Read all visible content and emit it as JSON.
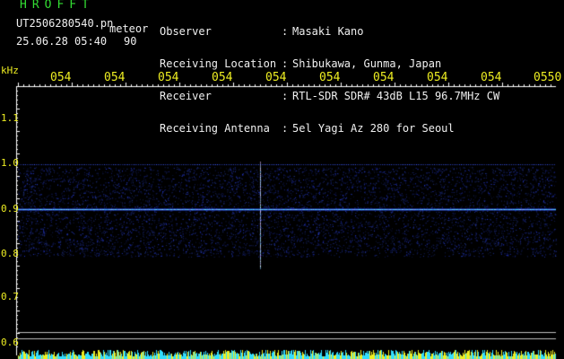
{
  "header": {
    "logo": "HROFFT",
    "filename": "UT2506280540.pn",
    "mode": "meteor",
    "datetime": "25.06.28 05:40",
    "level": "90",
    "fields": [
      {
        "label": "Observer",
        "value": "Masaki Kano"
      },
      {
        "label": "Receiving Location",
        "value": "Shibukawa, Gunma, Japan"
      },
      {
        "label": "Receiver",
        "value": "RTL-SDR SDR# 43dB L15 96.7MHz CW"
      },
      {
        "label": "Receiving Antenna",
        "value": "5el Yagi Az 280 for Seoul"
      }
    ],
    "separator": ":"
  },
  "axis": {
    "unit": "kHz",
    "time_ticks": [
      "054",
      "054",
      "054",
      "054",
      "054",
      "054",
      "054",
      "054",
      "054",
      "0550"
    ],
    "freq_ticks": [
      "1.1",
      "1.0",
      "0.9",
      "0.8",
      "0.7",
      "0.6"
    ]
  },
  "colors": {
    "background": "#000000",
    "title_green": "#33dd33",
    "tick_yellow": "#eeee22",
    "signal_blue": "#3355ff",
    "baseline_cyan": "#33ddff"
  }
}
